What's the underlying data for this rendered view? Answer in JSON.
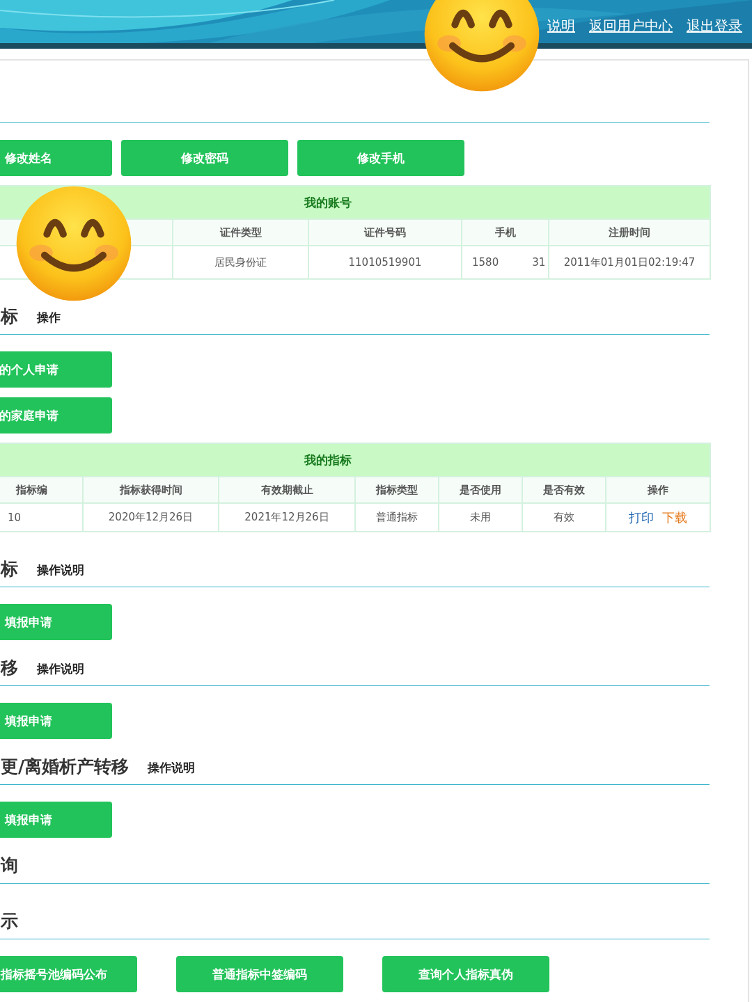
{
  "header": {
    "links": [
      "说明",
      "返回用户中心",
      "退出登录"
    ]
  },
  "stickers": [
    {
      "kind": "smiley"
    },
    {
      "kind": "smiley"
    }
  ],
  "sections": [
    {
      "kind": "row",
      "buttons": [
        "修改姓名",
        "修改密码",
        "修改手机"
      ],
      "table": {
        "title": "我的账号",
        "columns": [
          "",
          "证件类型",
          "证件号码",
          "手机",
          "注册时间"
        ],
        "rows": [
          [
            {
              "text": ""
            },
            {
              "text": "居民身份证"
            },
            {
              "text": "11010519901"
            },
            {
              "text": "1580",
              "tail": "31"
            },
            {
              "text": "2011年01月01日02:19:47"
            }
          ]
        ]
      }
    },
    {
      "kind": "stack",
      "title": "标",
      "help": "操作",
      "buttons": [
        "的个人申请",
        "的家庭申请"
      ],
      "table": {
        "title": "我的指标",
        "columns": [
          "指标编",
          "指标获得时间",
          "有效期截止",
          "指标类型",
          "是否使用",
          "是否有效",
          "操作"
        ],
        "rows": [
          [
            {
              "text": "10"
            },
            {
              "text": "2020年12月26日"
            },
            {
              "text": "2021年12月26日"
            },
            {
              "text": "普通指标"
            },
            {
              "text": "未用"
            },
            {
              "text": "有效"
            },
            {
              "kind": "actions",
              "links": [
                {
                  "text": "打印",
                  "color": "#2166b3"
                },
                {
                  "text": "下载",
                  "color": "#e5791b"
                }
              ]
            }
          ]
        ]
      }
    },
    {
      "kind": "row",
      "title": "标",
      "help": "操作说明",
      "buttons": [
        "填报申请"
      ]
    },
    {
      "kind": "row",
      "title": "移",
      "help": "操作说明",
      "buttons": [
        "填报申请"
      ]
    },
    {
      "kind": "row",
      "title": "更/离婚析产转移",
      "help": "操作说明",
      "buttons": [
        "填报申请"
      ]
    },
    {
      "kind": "row",
      "title": "询"
    },
    {
      "kind": "wide-row",
      "title": "示",
      "buttons": [
        "指标摇号池编码公布",
        "普通指标中签编码",
        "查询个人指标真伪"
      ]
    }
  ]
}
